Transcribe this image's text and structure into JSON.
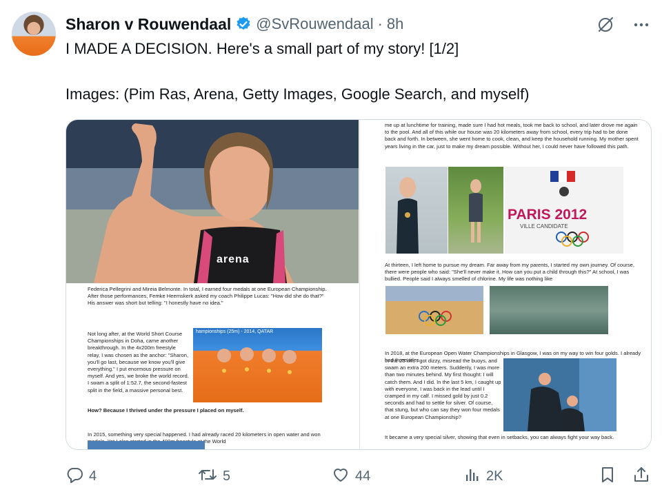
{
  "tweet": {
    "display_name": "Sharon v Rouwendaal",
    "handle": "@SvRouwendaal",
    "separator": "·",
    "time": "8h",
    "line1": "I MADE A DECISION. Here's a small part of my story! [1/2]",
    "line2": "Images: (Pim Ras, Arena, Getty Images, Google Search, and myself)"
  },
  "icons": {
    "verified": "verified-badge-icon",
    "grok": "grok-icon",
    "more": "more-icon",
    "reply": "reply-icon",
    "retweet": "retweet-icon",
    "like": "like-icon",
    "views": "views-icon",
    "bookmark": "bookmark-icon",
    "share": "share-icon"
  },
  "actions": {
    "replies": "4",
    "reposts": "5",
    "likes": "44",
    "views": "2K"
  },
  "media": {
    "left_page": {
      "hero_logo": "arena",
      "para1": "Federica Pellegrini and Mireia Belmonte. In total, I earned four medals at one European Championship. After those performances, Femke Heemskerk asked my coach Philippe Lucas: \"How did she do that?\" His answer was short but telling: \"I honestly have no idea.\"",
      "para2": "Not long after, at the World Short Course Championships in Doha, came another breakthrough. In the 4x200m freestyle relay, I was chosen as the anchor: \"Sharon, you'll go last, because we know you'll give everything.\" I put enormous pressure on myself. And yes, we broke the world record. I swam a split of 1:52.7, the second-fastest split in the field, a massive personal best.",
      "para2_bold": "How? Because I thrived under the pressure I placed on myself.",
      "podium_caption": "hampionships (25m) - 2014, QATAR",
      "para3": "In 2015, something very special happened. I had already raced 20 kilometers in open water and won medals. Yet I also started in the 400m freestyle at the World"
    },
    "right_page": {
      "r1": "me up at lunchtime for training, made sure I had hot meals, took me back to school, and later drove me again to the pool. And all of this while our house was 20 kilometers away from school, every trip had to be done back and forth. In between, she went home to cook, clean, and keep the household running. My mother spent years living in the car, just to make my dream possible. Without her, I could never have followed this path.",
      "paris_logo": "PARIS 2012",
      "paris_sub": "VILLE CANDIDATE",
      "r2": "At thirteen, I left home to pursue my dream. Far away from my parents, I started my own journey. Of course, there were people who said: \"She'll never make it. How can you put a child through this?\" At school, I was bullied. People said I always smelled of chlorine. My life was nothing like",
      "r3": "In 2018, at the European Open Water Championships in Glasgow, I was on my way to win four golds. I already had three titles.",
      "r3b": "In the 25 km, I got dizzy, misread the buoys, and swam an extra 200 meters. Suddenly, I was more than two minutes behind. My first thought: I will catch them. And I did. In the last 5 km, I caught up with everyone, I was back in the lead until I cramped in my calf. I missed gold by just 0.2 seconds and had to settle for silver. Of course, that stung, but who can say they won four medals at one European Championship?",
      "r4": "It became a very special silver, showing that even in setbacks, you can always fight your way back."
    }
  }
}
